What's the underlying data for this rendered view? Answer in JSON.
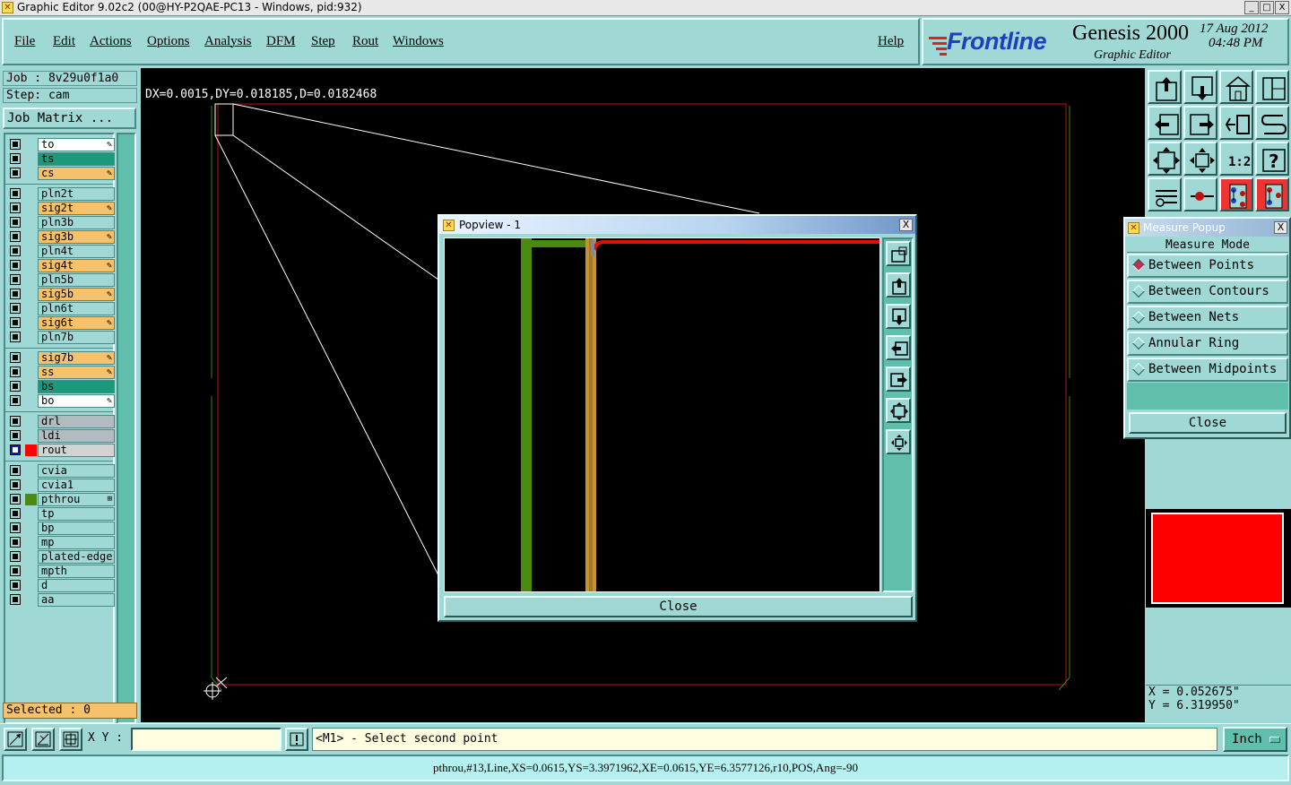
{
  "window": {
    "title": "Graphic Editor 9.02c2 (00@HY-P2QAE-PC13 - Windows, pid:932)",
    "controls": [
      "_",
      "□",
      "X"
    ]
  },
  "menu": {
    "items": [
      "File",
      "Edit",
      "Actions",
      "Options",
      "Analysis",
      "DFM",
      "Step",
      "Rout",
      "Windows"
    ],
    "help": "Help"
  },
  "brand": {
    "logo": "Frontline",
    "product": "Genesis 2000",
    "subtitle": "Graphic Editor",
    "date": "17 Aug 2012",
    "time": "04:48 PM"
  },
  "job": {
    "job_label": "Job : 8v29u0f1a0",
    "step_label": "Step: cam",
    "matrix_button": "Job Matrix ..."
  },
  "layers": {
    "group1": [
      {
        "name": "to",
        "color": "#ffffff",
        "editable": true
      },
      {
        "name": "ts",
        "color": "#1a9a7a",
        "editable": false
      },
      {
        "name": "cs",
        "color": "#f5c16a",
        "editable": true
      }
    ],
    "group2": [
      {
        "name": "pln2t",
        "color": "#9fd8d4",
        "editable": false
      },
      {
        "name": "sig2t",
        "color": "#f5c16a",
        "editable": true
      },
      {
        "name": "pln3b",
        "color": "#9fd8d4",
        "editable": false
      },
      {
        "name": "sig3b",
        "color": "#f5c16a",
        "editable": true
      },
      {
        "name": "pln4t",
        "color": "#9fd8d4",
        "editable": false
      },
      {
        "name": "sig4t",
        "color": "#f5c16a",
        "editable": true
      },
      {
        "name": "pln5b",
        "color": "#9fd8d4",
        "editable": false
      },
      {
        "name": "sig5b",
        "color": "#f5c16a",
        "editable": true
      },
      {
        "name": "pln6t",
        "color": "#9fd8d4",
        "editable": false
      },
      {
        "name": "sig6t",
        "color": "#f5c16a",
        "editable": true
      },
      {
        "name": "pln7b",
        "color": "#9fd8d4",
        "editable": false
      }
    ],
    "group3": [
      {
        "name": "sig7b",
        "color": "#f5c16a",
        "editable": true
      },
      {
        "name": "ss",
        "color": "#f5c16a",
        "editable": true
      },
      {
        "name": "bs",
        "color": "#1a9a7a",
        "editable": false
      },
      {
        "name": "bo",
        "color": "#ffffff",
        "editable": true
      }
    ],
    "group4": [
      {
        "name": "drl",
        "color": "#b0bcc0",
        "editable": false
      },
      {
        "name": "ldi",
        "color": "#b0bcc0",
        "editable": false
      },
      {
        "name": "rout",
        "color": "#d0d4d4",
        "editable": false,
        "active": true,
        "swatch": "#ff0000"
      }
    ],
    "group5": [
      {
        "name": "cvia",
        "color": "#9fd8d4",
        "editable": false
      },
      {
        "name": "cvia1",
        "color": "#9fd8d4",
        "editable": false
      },
      {
        "name": "pthrou",
        "color": "#9fd8d4",
        "editable": false,
        "swatch": "#4a8a10",
        "mark": "⊞"
      },
      {
        "name": "tp",
        "color": "#9fd8d4",
        "editable": false
      },
      {
        "name": "bp",
        "color": "#9fd8d4",
        "editable": false
      },
      {
        "name": "mp",
        "color": "#9fd8d4",
        "editable": false
      },
      {
        "name": "plated-edge",
        "color": "#9fd8d4",
        "editable": false
      },
      {
        "name": "mpth",
        "color": "#9fd8d4",
        "editable": false
      },
      {
        "name": "d",
        "color": "#9fd8d4",
        "editable": false
      },
      {
        "name": "aa",
        "color": "#9fd8d4",
        "editable": false
      }
    ],
    "edit_mark": "✎"
  },
  "selected": "Selected : 0",
  "measure_readout": "DX=0.0015,DY=0.018185,D=0.0182468",
  "popview": {
    "title": "Popview - 1",
    "close_x": "X",
    "close_button": "Close"
  },
  "measure_popup": {
    "title": "Measure Popup",
    "close_x": "X",
    "heading": "Measure Mode",
    "options": [
      "Between Points",
      "Between Contours",
      "Between Nets",
      "Annular Ring",
      "Between Midpoints"
    ],
    "selected_index": 0,
    "close_button": "Close"
  },
  "toolbar_icons": [
    "pan-up-icon",
    "pan-down-icon",
    "home-icon",
    "split-view-icon",
    "pan-left-icon",
    "pan-right-icon",
    "undo-zoom-icon",
    "redraw-icon",
    "zoom-fit-icon",
    "zoom-center-icon",
    "one-to-one-icon",
    "help-icon",
    "tools-icon",
    "snap-icon",
    "net-display-icon",
    "net-highlight-icon"
  ],
  "coords": {
    "x": "X = 0.052675\"",
    "y": "Y = 6.319950\""
  },
  "bottom": {
    "xy_label": "X Y :",
    "xy_value": "",
    "prompt": "<M1> - Select second point",
    "unit": "Inch"
  },
  "status": "pthrou,#13,Line,XS=0.0615,YS=3.3971962,XE=0.0615,YE=6.3577126,r10,POS,Ang=-90"
}
